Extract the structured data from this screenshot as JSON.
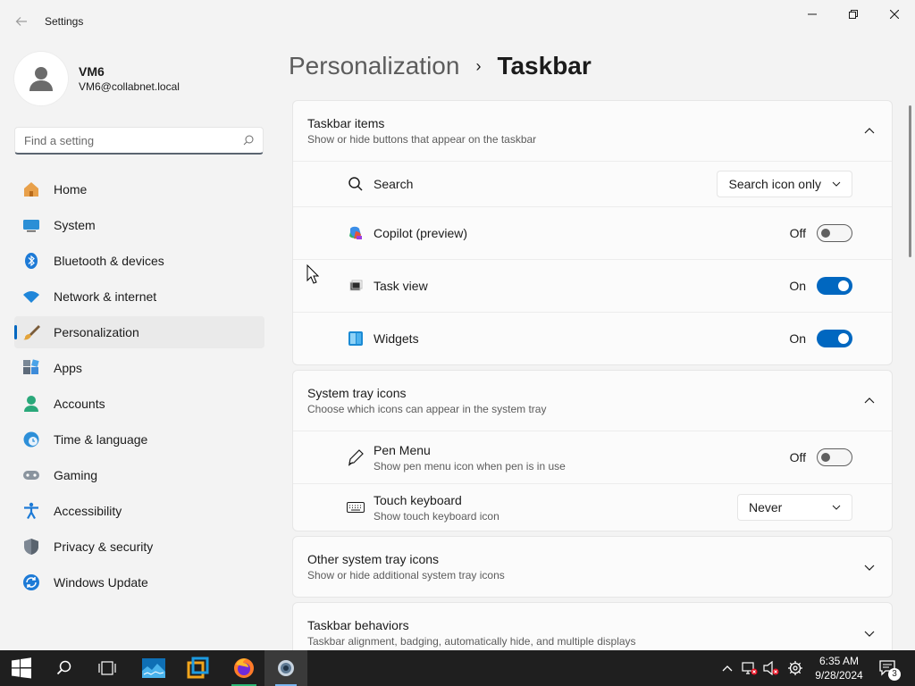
{
  "window": {
    "title": "Settings"
  },
  "profile": {
    "name": "VM6",
    "email": "VM6@collabnet.local"
  },
  "search": {
    "placeholder": "Find a setting"
  },
  "sidebar": {
    "items": [
      {
        "label": "Home",
        "icon": "home-icon"
      },
      {
        "label": "System",
        "icon": "system-icon"
      },
      {
        "label": "Bluetooth & devices",
        "icon": "bluetooth-icon"
      },
      {
        "label": "Network & internet",
        "icon": "network-icon"
      },
      {
        "label": "Personalization",
        "icon": "personalization-icon",
        "active": true
      },
      {
        "label": "Apps",
        "icon": "apps-icon"
      },
      {
        "label": "Accounts",
        "icon": "accounts-icon"
      },
      {
        "label": "Time & language",
        "icon": "time-language-icon"
      },
      {
        "label": "Gaming",
        "icon": "gaming-icon"
      },
      {
        "label": "Accessibility",
        "icon": "accessibility-icon"
      },
      {
        "label": "Privacy & security",
        "icon": "shield-icon"
      },
      {
        "label": "Windows Update",
        "icon": "windows-update-icon"
      }
    ]
  },
  "breadcrumb": {
    "parent": "Personalization",
    "separator": "›",
    "current": "Taskbar"
  },
  "sections": {
    "taskbar_items": {
      "title": "Taskbar items",
      "subtitle": "Show or hide buttons that appear on the taskbar",
      "rows": {
        "search": {
          "label": "Search",
          "value": "Search icon only"
        },
        "copilot": {
          "label": "Copilot (preview)",
          "state": "Off"
        },
        "task_view": {
          "label": "Task view",
          "state": "On"
        },
        "widgets": {
          "label": "Widgets",
          "state": "On"
        }
      }
    },
    "system_tray": {
      "title": "System tray icons",
      "subtitle": "Choose which icons can appear in the system tray",
      "rows": {
        "pen_menu": {
          "label": "Pen Menu",
          "subtitle": "Show pen menu icon when pen is in use",
          "state": "Off"
        },
        "touch_keyboard": {
          "label": "Touch keyboard",
          "subtitle": "Show touch keyboard icon",
          "value": "Never"
        }
      }
    },
    "other_tray": {
      "title": "Other system tray icons",
      "subtitle": "Show or hide additional system tray icons"
    },
    "behaviors": {
      "title": "Taskbar behaviors",
      "subtitle": "Taskbar alignment, badging, automatically hide, and multiple displays"
    }
  },
  "taskbar": {
    "time": "6:35 AM",
    "date": "9/28/2024",
    "notification_count": "3"
  },
  "colors": {
    "accent": "#0067c0",
    "taskbar": "#1f1f1f"
  }
}
